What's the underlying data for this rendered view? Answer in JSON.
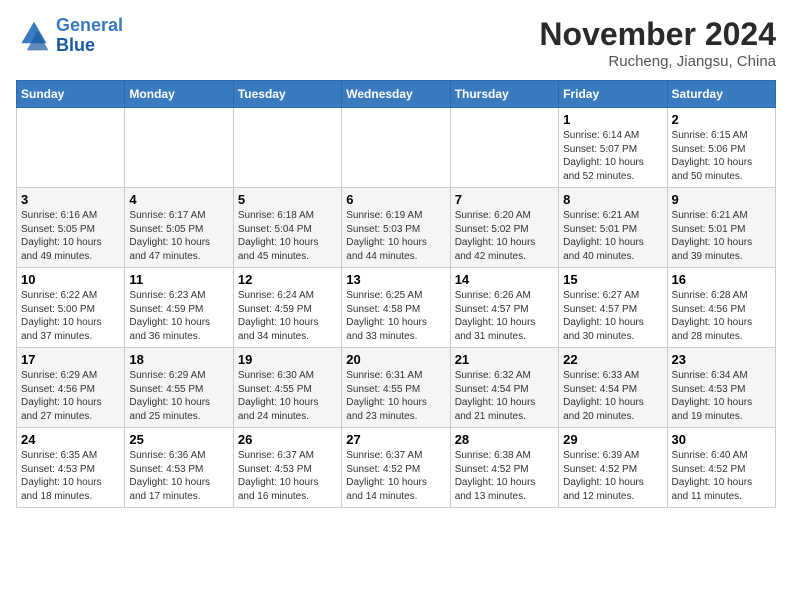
{
  "header": {
    "logo_line1": "General",
    "logo_line2": "Blue",
    "month": "November 2024",
    "location": "Rucheng, Jiangsu, China"
  },
  "weekdays": [
    "Sunday",
    "Monday",
    "Tuesday",
    "Wednesday",
    "Thursday",
    "Friday",
    "Saturday"
  ],
  "weeks": [
    [
      {
        "num": "",
        "info": ""
      },
      {
        "num": "",
        "info": ""
      },
      {
        "num": "",
        "info": ""
      },
      {
        "num": "",
        "info": ""
      },
      {
        "num": "",
        "info": ""
      },
      {
        "num": "1",
        "info": "Sunrise: 6:14 AM\nSunset: 5:07 PM\nDaylight: 10 hours and 52 minutes."
      },
      {
        "num": "2",
        "info": "Sunrise: 6:15 AM\nSunset: 5:06 PM\nDaylight: 10 hours and 50 minutes."
      }
    ],
    [
      {
        "num": "3",
        "info": "Sunrise: 6:16 AM\nSunset: 5:05 PM\nDaylight: 10 hours and 49 minutes."
      },
      {
        "num": "4",
        "info": "Sunrise: 6:17 AM\nSunset: 5:05 PM\nDaylight: 10 hours and 47 minutes."
      },
      {
        "num": "5",
        "info": "Sunrise: 6:18 AM\nSunset: 5:04 PM\nDaylight: 10 hours and 45 minutes."
      },
      {
        "num": "6",
        "info": "Sunrise: 6:19 AM\nSunset: 5:03 PM\nDaylight: 10 hours and 44 minutes."
      },
      {
        "num": "7",
        "info": "Sunrise: 6:20 AM\nSunset: 5:02 PM\nDaylight: 10 hours and 42 minutes."
      },
      {
        "num": "8",
        "info": "Sunrise: 6:21 AM\nSunset: 5:01 PM\nDaylight: 10 hours and 40 minutes."
      },
      {
        "num": "9",
        "info": "Sunrise: 6:21 AM\nSunset: 5:01 PM\nDaylight: 10 hours and 39 minutes."
      }
    ],
    [
      {
        "num": "10",
        "info": "Sunrise: 6:22 AM\nSunset: 5:00 PM\nDaylight: 10 hours and 37 minutes."
      },
      {
        "num": "11",
        "info": "Sunrise: 6:23 AM\nSunset: 4:59 PM\nDaylight: 10 hours and 36 minutes."
      },
      {
        "num": "12",
        "info": "Sunrise: 6:24 AM\nSunset: 4:59 PM\nDaylight: 10 hours and 34 minutes."
      },
      {
        "num": "13",
        "info": "Sunrise: 6:25 AM\nSunset: 4:58 PM\nDaylight: 10 hours and 33 minutes."
      },
      {
        "num": "14",
        "info": "Sunrise: 6:26 AM\nSunset: 4:57 PM\nDaylight: 10 hours and 31 minutes."
      },
      {
        "num": "15",
        "info": "Sunrise: 6:27 AM\nSunset: 4:57 PM\nDaylight: 10 hours and 30 minutes."
      },
      {
        "num": "16",
        "info": "Sunrise: 6:28 AM\nSunset: 4:56 PM\nDaylight: 10 hours and 28 minutes."
      }
    ],
    [
      {
        "num": "17",
        "info": "Sunrise: 6:29 AM\nSunset: 4:56 PM\nDaylight: 10 hours and 27 minutes."
      },
      {
        "num": "18",
        "info": "Sunrise: 6:29 AM\nSunset: 4:55 PM\nDaylight: 10 hours and 25 minutes."
      },
      {
        "num": "19",
        "info": "Sunrise: 6:30 AM\nSunset: 4:55 PM\nDaylight: 10 hours and 24 minutes."
      },
      {
        "num": "20",
        "info": "Sunrise: 6:31 AM\nSunset: 4:55 PM\nDaylight: 10 hours and 23 minutes."
      },
      {
        "num": "21",
        "info": "Sunrise: 6:32 AM\nSunset: 4:54 PM\nDaylight: 10 hours and 21 minutes."
      },
      {
        "num": "22",
        "info": "Sunrise: 6:33 AM\nSunset: 4:54 PM\nDaylight: 10 hours and 20 minutes."
      },
      {
        "num": "23",
        "info": "Sunrise: 6:34 AM\nSunset: 4:53 PM\nDaylight: 10 hours and 19 minutes."
      }
    ],
    [
      {
        "num": "24",
        "info": "Sunrise: 6:35 AM\nSunset: 4:53 PM\nDaylight: 10 hours and 18 minutes."
      },
      {
        "num": "25",
        "info": "Sunrise: 6:36 AM\nSunset: 4:53 PM\nDaylight: 10 hours and 17 minutes."
      },
      {
        "num": "26",
        "info": "Sunrise: 6:37 AM\nSunset: 4:53 PM\nDaylight: 10 hours and 16 minutes."
      },
      {
        "num": "27",
        "info": "Sunrise: 6:37 AM\nSunset: 4:52 PM\nDaylight: 10 hours and 14 minutes."
      },
      {
        "num": "28",
        "info": "Sunrise: 6:38 AM\nSunset: 4:52 PM\nDaylight: 10 hours and 13 minutes."
      },
      {
        "num": "29",
        "info": "Sunrise: 6:39 AM\nSunset: 4:52 PM\nDaylight: 10 hours and 12 minutes."
      },
      {
        "num": "30",
        "info": "Sunrise: 6:40 AM\nSunset: 4:52 PM\nDaylight: 10 hours and 11 minutes."
      }
    ]
  ]
}
